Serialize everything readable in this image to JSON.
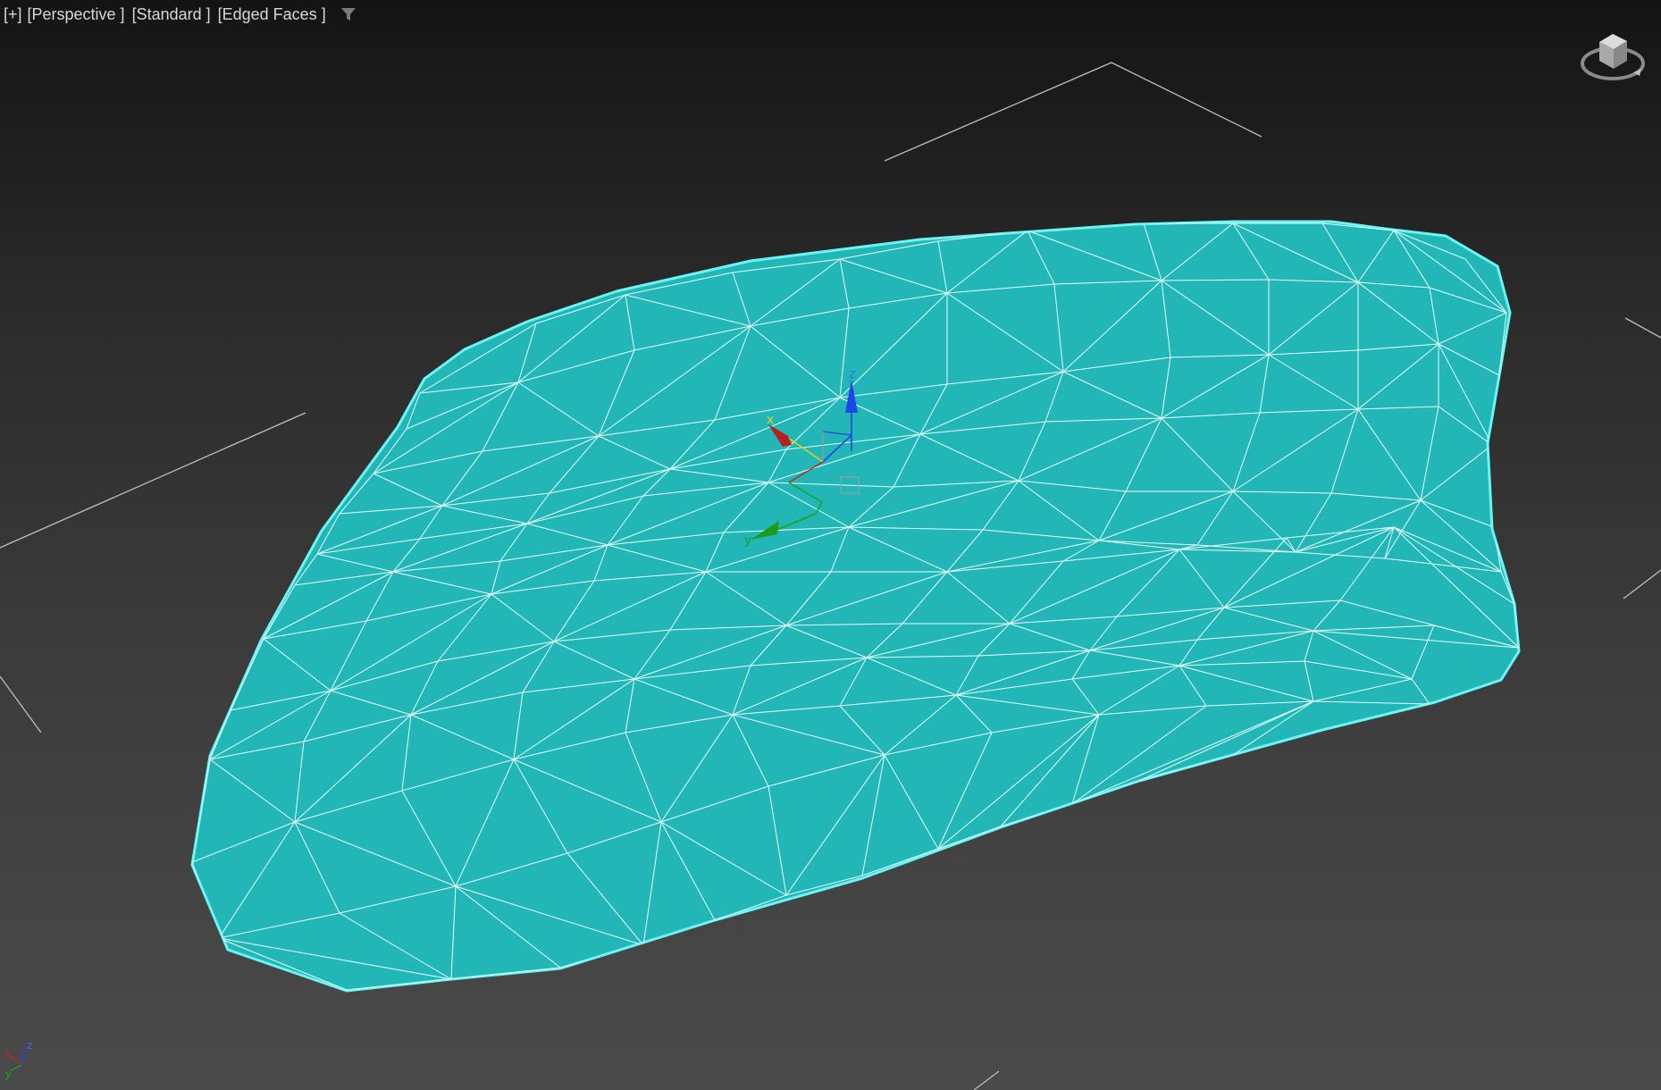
{
  "viewport": {
    "labels": [
      "[+]",
      "[Perspective ]",
      "[Standard ]",
      "[Edged Faces ]"
    ],
    "icons": {
      "filter": "filter-icon",
      "viewcube": "viewcube-icon",
      "world_axis": "world-axis-tripod"
    }
  },
  "colors": {
    "mesh_fill": "#22b6b6",
    "mesh_edges": "#e6ffff",
    "selection_outline": "#6cf4f4",
    "grid_lines": "#bfbfbf",
    "axis_x": "#c82020",
    "axis_y": "#1ea01e",
    "axis_z": "#1e46e6",
    "axis_x_label": "#e6d21e"
  },
  "gizmo": {
    "x_label": "x",
    "y_label": "y",
    "z_label": "z"
  },
  "world_axes": {
    "x_label": "x",
    "y_label": "y",
    "z_label": "z"
  }
}
